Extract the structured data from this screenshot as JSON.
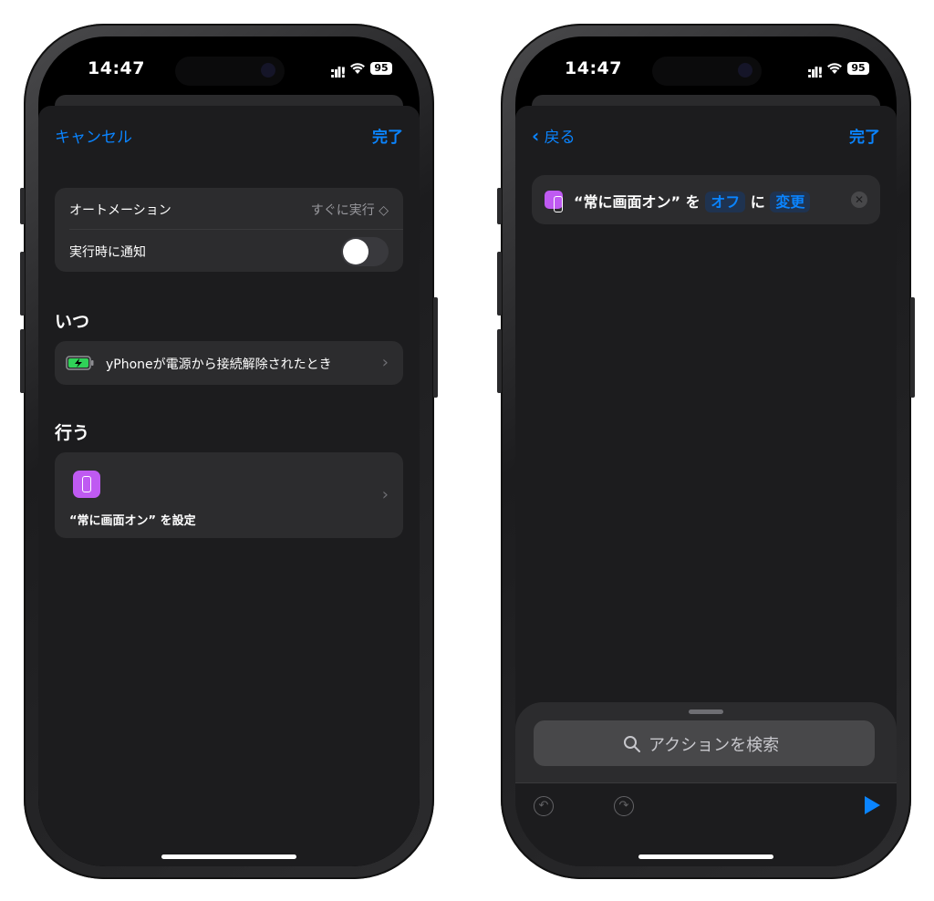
{
  "status": {
    "time": "14:47",
    "battery": "95"
  },
  "left": {
    "cancel": "キャンセル",
    "done": "完了",
    "automation_label": "オートメーション",
    "automation_value": "すぐに実行 ◇",
    "notify_label": "実行時に通知",
    "when_heading": "いつ",
    "trigger_text": "yPhoneが電源から接続解除されたとき",
    "do_heading": "行う",
    "action_text": "“常に画面オン” を設定"
  },
  "right": {
    "back": "戻る",
    "done": "完了",
    "action": {
      "prefix": "“常に画面オン” を",
      "value": "オフ",
      "mid": "に",
      "verb": "変更"
    },
    "search_placeholder": "アクションを検索"
  },
  "colors": {
    "accent": "#0a84ff",
    "shortcut_icon": "#bf5af2",
    "battery_icon": "#30d158"
  },
  "icons": [
    "chevron-left-icon",
    "chevron-right-icon",
    "search-icon",
    "undo-icon",
    "redo-icon",
    "play-icon",
    "close-icon",
    "battery-charging-icon",
    "display-icon"
  ]
}
